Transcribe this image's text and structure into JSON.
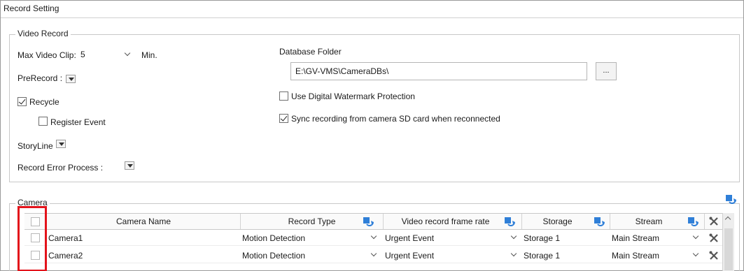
{
  "window": {
    "title": "Record Setting"
  },
  "video_record": {
    "legend": "Video Record",
    "max_video_clip_label": "Max Video Clip:",
    "max_video_clip_value": "5",
    "max_video_clip_unit": "Min.",
    "prerecord_label": "PreRecord :",
    "recycle_label": "Recycle",
    "recycle_checked": true,
    "register_event_label": "Register Event",
    "register_event_checked": false,
    "storyline_label": "StoryLine",
    "record_error_label": "Record Error Process :",
    "database_folder_label": "Database Folder",
    "database_folder_value": "E:\\GV-VMS\\CameraDBs\\",
    "browse_label": "...",
    "watermark_label": "Use Digital Watermark Protection",
    "watermark_checked": false,
    "sync_label": "Sync recording from camera SD card when reconnected",
    "sync_checked": true
  },
  "camera": {
    "legend": "Camera",
    "columns": {
      "name": "Camera Name",
      "record_type": "Record Type",
      "frame_rate": "Video record frame rate",
      "storage": "Storage",
      "stream": "Stream"
    },
    "rows": [
      {
        "name": "Camera1",
        "record_type": "Motion Detection",
        "frame_rate": "Urgent Event",
        "storage": "Storage 1",
        "stream": "Main Stream"
      },
      {
        "name": "Camera2",
        "record_type": "Motion Detection",
        "frame_rate": "Urgent Event",
        "storage": "Storage 1",
        "stream": "Main Stream"
      }
    ]
  },
  "colors": {
    "accent_blue": "#2f7fd8",
    "highlight_red": "#e3131b"
  }
}
